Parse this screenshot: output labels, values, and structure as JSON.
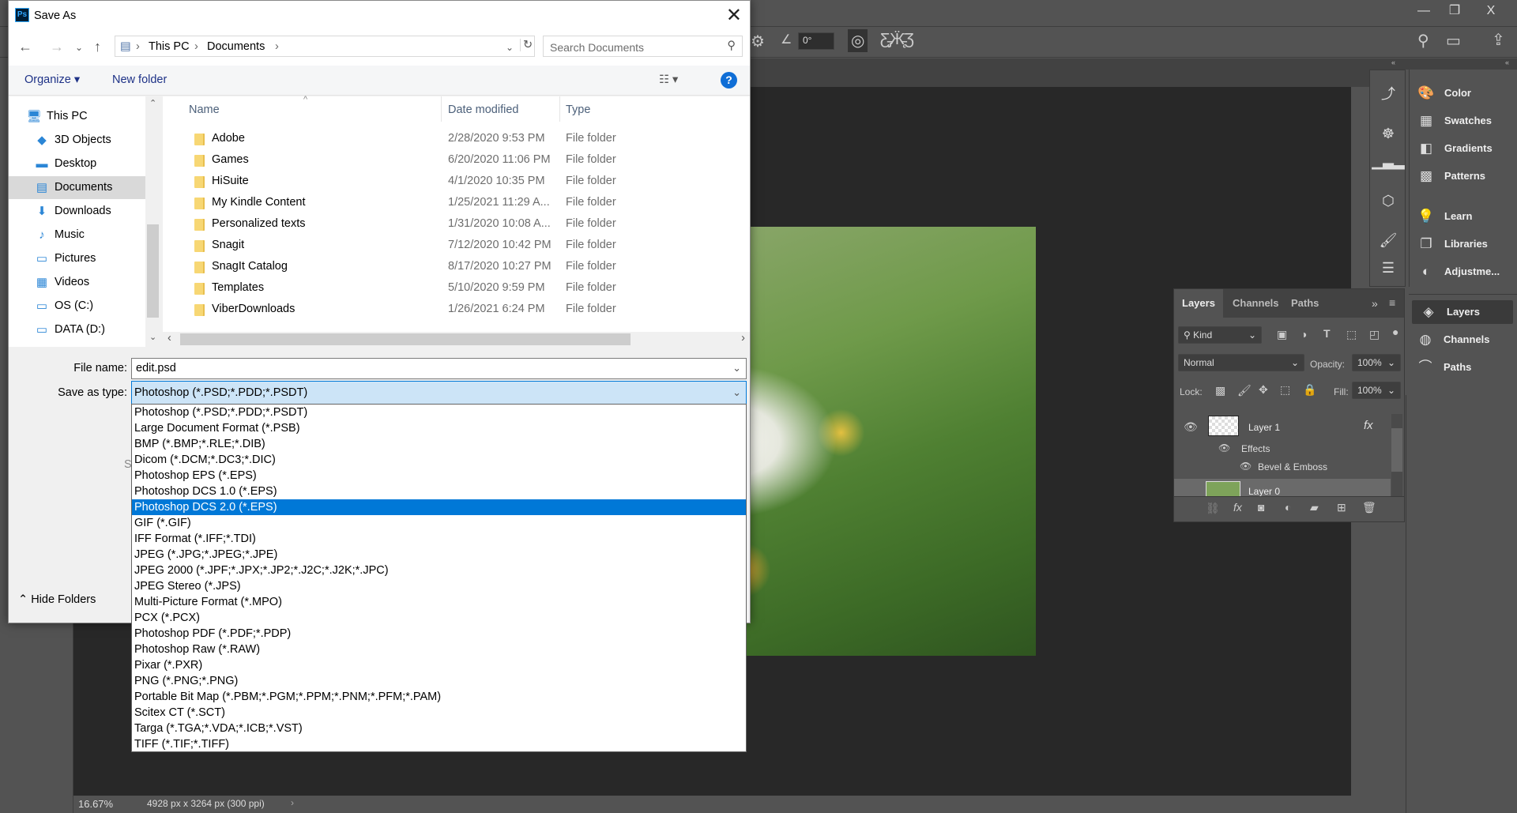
{
  "photoshop": {
    "window_controls": [
      "—",
      "❐",
      "X"
    ],
    "options": {
      "angle": "0°"
    },
    "status": {
      "zoom": "16.67%",
      "dimensions": "4928 px x 3264 px (300 ppi)"
    },
    "dock_icons": [
      "history-icon",
      "navigator-icon",
      "histogram-icon",
      "properties-icon",
      "brushes-icon",
      "adjust-icon"
    ],
    "dock_panels": [
      {
        "icon": "palette-icon",
        "label": "Color"
      },
      {
        "icon": "swatches-icon",
        "label": "Swatches"
      },
      {
        "icon": "gradients-icon",
        "label": "Gradients"
      },
      {
        "icon": "patterns-icon",
        "label": "Patterns"
      },
      {
        "icon": "lightbulb-icon",
        "label": "Learn"
      },
      {
        "icon": "libraries-icon",
        "label": "Libraries"
      },
      {
        "icon": "adjustments-icon",
        "label": "Adjustme..."
      }
    ],
    "dock_panels2": [
      {
        "icon": "layers-icon",
        "label": "Layers"
      },
      {
        "icon": "channels-icon",
        "label": "Channels"
      },
      {
        "icon": "paths-icon",
        "label": "Paths"
      }
    ],
    "layers_panel": {
      "tabs": [
        "Layers",
        "Channels",
        "Paths"
      ],
      "filter": "Kind",
      "blend_mode": "Normal",
      "opacity_label": "Opacity:",
      "opacity": "100%",
      "lock_label": "Lock:",
      "fill_label": "Fill:",
      "fill": "100%",
      "layers": [
        {
          "name": "Layer 1",
          "fx": "fx",
          "effects_label": "Effects",
          "effect": "Bevel & Emboss"
        },
        {
          "name": "Layer 0"
        }
      ]
    }
  },
  "dialog": {
    "title": "Save As",
    "breadcrumb": [
      "This PC",
      "Documents"
    ],
    "search_placeholder": "Search Documents",
    "organize": "Organize ▾",
    "new_folder": "New folder",
    "help": "?",
    "nav": [
      {
        "label": "This PC",
        "icon": "computer-icon",
        "glyph": "🖥",
        "indent": 0
      },
      {
        "label": "3D Objects",
        "icon": "cube-icon",
        "glyph": "◆",
        "indent": 1
      },
      {
        "label": "Desktop",
        "icon": "desktop-icon",
        "glyph": "▬",
        "indent": 1
      },
      {
        "label": "Documents",
        "icon": "document-icon",
        "glyph": "▤",
        "indent": 1,
        "selected": true
      },
      {
        "label": "Downloads",
        "icon": "download-icon",
        "glyph": "⬇",
        "indent": 1
      },
      {
        "label": "Music",
        "icon": "music-icon",
        "glyph": "♪",
        "indent": 1
      },
      {
        "label": "Pictures",
        "icon": "pictures-icon",
        "glyph": "▭",
        "indent": 1
      },
      {
        "label": "Videos",
        "icon": "videos-icon",
        "glyph": "▦",
        "indent": 1
      },
      {
        "label": "OS (C:)",
        "icon": "drive-icon",
        "glyph": "▭",
        "indent": 1
      },
      {
        "label": "DATA (D:)",
        "icon": "drive-icon",
        "glyph": "▭",
        "indent": 1
      }
    ],
    "columns": [
      "Name",
      "Date modified",
      "Type"
    ],
    "files": [
      {
        "name": "Adobe",
        "date": "2/28/2020 9:53 PM",
        "type": "File folder"
      },
      {
        "name": "Games",
        "date": "6/20/2020 11:06 PM",
        "type": "File folder"
      },
      {
        "name": "HiSuite",
        "date": "4/1/2020 10:35 PM",
        "type": "File folder"
      },
      {
        "name": "My Kindle Content",
        "date": "1/25/2021 11:29 A...",
        "type": "File folder"
      },
      {
        "name": "Personalized texts",
        "date": "1/31/2020 10:08 A...",
        "type": "File folder"
      },
      {
        "name": "Snagit",
        "date": "7/12/2020 10:42 PM",
        "type": "File folder"
      },
      {
        "name": "SnagIt Catalog",
        "date": "8/17/2020 10:27 PM",
        "type": "File folder"
      },
      {
        "name": "Templates",
        "date": "5/10/2020 9:59 PM",
        "type": "File folder"
      },
      {
        "name": "ViberDownloads",
        "date": "1/26/2021 6:24 PM",
        "type": "File folder"
      }
    ],
    "file_name_label": "File name:",
    "file_name": "edit.psd",
    "save_type_label": "Save as type:",
    "save_type": "Photoshop (*.PSD;*.PDD;*.PSDT)",
    "hidden_label_fragment": "S",
    "hide_folders": "Hide Folders",
    "type_options": [
      "Photoshop (*.PSD;*.PDD;*.PSDT)",
      "Large Document Format (*.PSB)",
      "BMP (*.BMP;*.RLE;*.DIB)",
      "Dicom (*.DCM;*.DC3;*.DIC)",
      "Photoshop EPS (*.EPS)",
      "Photoshop DCS 1.0 (*.EPS)",
      "Photoshop DCS 2.0 (*.EPS)",
      "GIF (*.GIF)",
      "IFF Format (*.IFF;*.TDI)",
      "JPEG (*.JPG;*.JPEG;*.JPE)",
      "JPEG 2000 (*.JPF;*.JPX;*.JP2;*.J2C;*.J2K;*.JPC)",
      "JPEG Stereo (*.JPS)",
      "Multi-Picture Format (*.MPO)",
      "PCX (*.PCX)",
      "Photoshop PDF (*.PDF;*.PDP)",
      "Photoshop Raw (*.RAW)",
      "Pixar (*.PXR)",
      "PNG (*.PNG;*.PNG)",
      "Portable Bit Map (*.PBM;*.PGM;*.PPM;*.PNM;*.PFM;*.PAM)",
      "Scitex CT (*.SCT)",
      "Targa (*.TGA;*.VDA;*.ICB;*.VST)",
      "TIFF (*.TIF;*.TIFF)"
    ],
    "highlighted_option": "Photoshop DCS 2.0 (*.EPS)",
    "accent": "#0078d7"
  }
}
